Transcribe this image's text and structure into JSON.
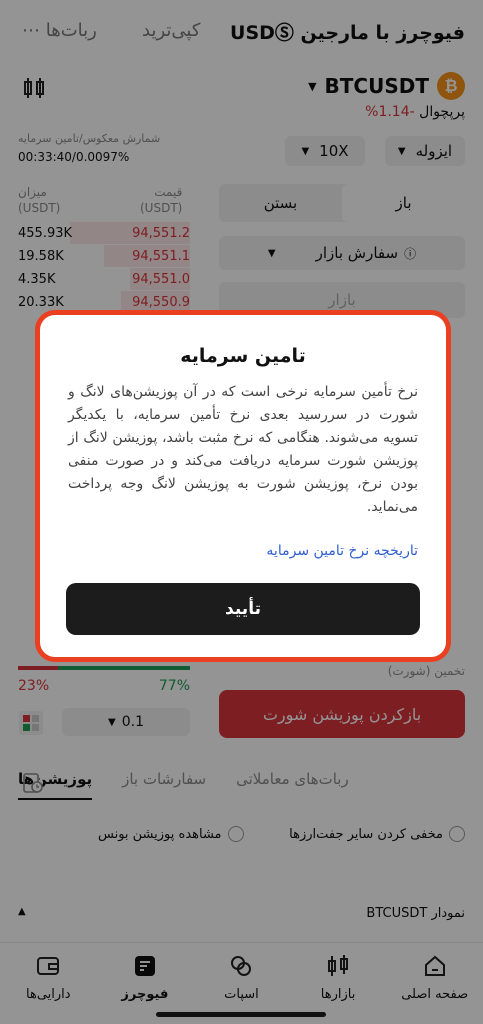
{
  "topnav": {
    "title": "فیوچرز با مارجین USDⓈ",
    "copy_trade": "کپی‌ترید",
    "bots": "ربات‌ها"
  },
  "pair": {
    "coin_letter": "₿",
    "name": "BTCUSDT",
    "type": "پرپچوال",
    "change": "-1.14%"
  },
  "controls": {
    "margin_mode": "ایزوله",
    "leverage": "10X",
    "order_type": "سفارش بازار",
    "market_placeholder": "بازار"
  },
  "funding": {
    "label": "شمارش معکوس/تامین سرمایه",
    "value": "00:33:40/0.0097%"
  },
  "orderbook": {
    "price_header": "قیمت\n(USDT)",
    "amount_header": "میزان\n(USDT)",
    "asks": [
      {
        "price": "94,551.2",
        "amount": "455.93K",
        "depth": 0.7
      },
      {
        "price": "94,551.1",
        "amount": "19.58K",
        "depth": 0.5
      },
      {
        "price": "94,551.0",
        "amount": "4.35K",
        "depth": 0.35
      },
      {
        "price": "94,550.9",
        "amount": "20.33K",
        "depth": 0.4
      }
    ],
    "buy_pct": "77%",
    "sell_pct": "23%",
    "tick": "0.1"
  },
  "side": {
    "open": "باز",
    "close": "بستن"
  },
  "order": {
    "estimate_label": "تخمین (شورت)",
    "short_button": "بازکردن پوزیشن شورت"
  },
  "tabs": {
    "positions": "پوزیشن‌ها",
    "open_orders": "سفارشات باز",
    "bots": "ربات‌های معاملاتی"
  },
  "options": {
    "hide_pairs": "مخفی کردن سایر جفت‌ارزها",
    "show_bonus": "مشاهده پوزیشن بونس"
  },
  "chart_row": {
    "label": "نمودار BTCUSDT"
  },
  "bottom_nav": {
    "home": "صفحه اصلی",
    "markets": "بازارها",
    "spot": "اسپات",
    "futures": "فیوچرز",
    "assets": "دارایی‌ها"
  },
  "modal": {
    "title": "تامین سرمایه",
    "body": "نرخ تأمین سرمایه نرخی است که در آن پوزیشن‌های لانگ و شورت در سررسید بعدی نرخ تأمین سرمایه، با یکدیگر تسویه می‌شوند. هنگامی که نرخ مثبت باشد، پوزیشن لانگ از پوزیشن شورت سرمایه دریافت می‌کند و در صورت منفی بودن نرخ، پوزیشن شورت به پوزیشن لانگ وجه پرداخت می‌نماید.",
    "link": "تاریخچه نرخ تامین سرمایه",
    "confirm": "تأیید"
  },
  "colors": {
    "accent_red": "#d8343d",
    "accent_green": "#1f9b55",
    "modal_border": "#ea3f20",
    "coin": "#f7931a"
  }
}
